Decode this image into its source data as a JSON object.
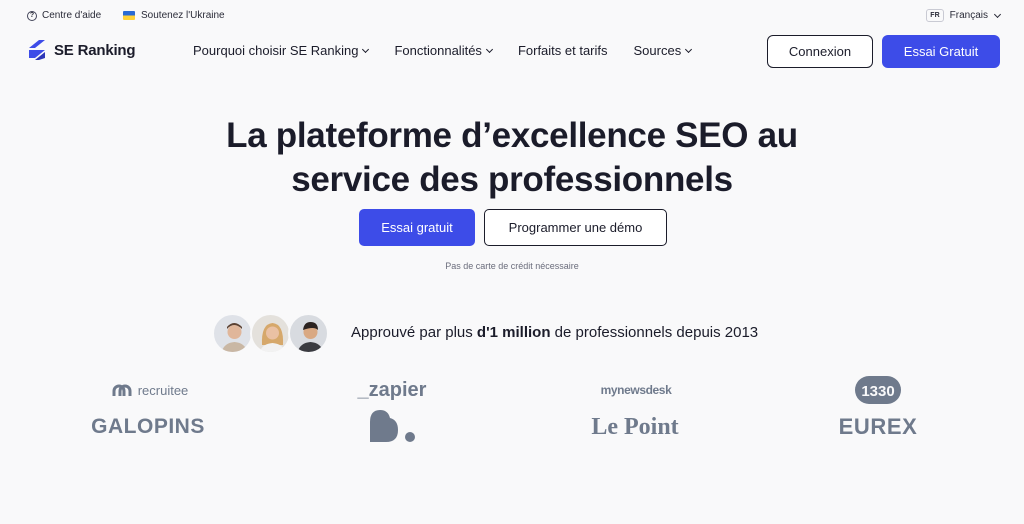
{
  "topbar": {
    "help_label": "Centre d'aide",
    "ukraine_label": "Soutenez l'Ukraine",
    "lang_code": "FR",
    "lang_label": "Français"
  },
  "brand": {
    "name": "SE Ranking",
    "accent": "#3d4ce8"
  },
  "nav": {
    "items": [
      {
        "label": "Pourquoi choisir SE Ranking",
        "has_dropdown": true
      },
      {
        "label": "Fonctionnalités",
        "has_dropdown": true
      },
      {
        "label": "Forfaits et tarifs",
        "has_dropdown": false
      },
      {
        "label": "Sources",
        "has_dropdown": true
      }
    ],
    "login_label": "Connexion",
    "trial_label": "Essai Gratuit"
  },
  "hero": {
    "title_line1": "La plateforme d’excellence SEO au",
    "title_line2": "service des professionnels",
    "cta_primary": "Essai gratuit",
    "cta_secondary": "Programmer une démo",
    "note": "Pas de carte de crédit nécessaire"
  },
  "proof": {
    "prefix": "Approuvé par plus ",
    "highlight": "d'1 million",
    "suffix": " de professionnels depuis 2013"
  },
  "logos": {
    "recruitee": "recruitee",
    "galopins": "GALOPINS",
    "zapier": "_zapier",
    "newsdesk": "mynewsdesk",
    "lepoint": "Le Point",
    "ch130": "1330",
    "eurex": "EUREX"
  }
}
